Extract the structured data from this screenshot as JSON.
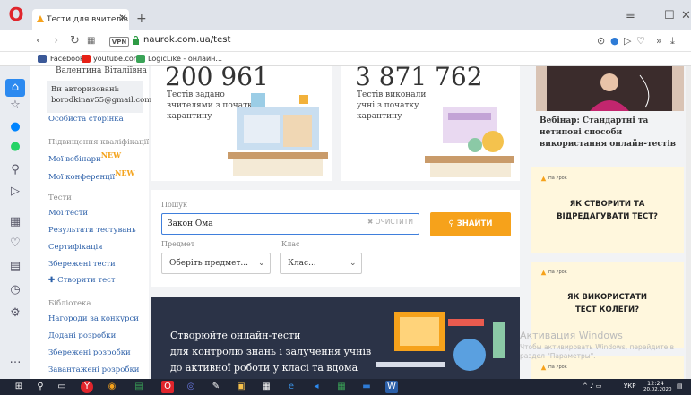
{
  "browser": {
    "tab_title": "Тести для вчителів різни",
    "tab_close": "✕",
    "new_tab": "+",
    "url": "naurok.com.ua/test",
    "vpn_label": "VPN",
    "bookmarks": [
      "Facebook",
      "youtube.com",
      "LogicLike - онлайн..."
    ]
  },
  "sidebar": {
    "user_name": "Валентина Віталіївна",
    "auth_line1": "Ви авторизовані:",
    "auth_line2": "borodkinav55@gmail.com",
    "personal_page": "Особиста сторінка",
    "sec_qualification": "Підвищення кваліфікації",
    "my_webinars": "Мої вебінари",
    "my_conferences": "Мої конференції",
    "new_badge": "NEW",
    "sec_tests": "Тести",
    "my_tests": "Мої тести",
    "test_results": "Результати тестувань",
    "certification": "Сертифікація",
    "saved_tests": "Збережені тести",
    "create_test": "Створити тест",
    "sec_library": "Бібліотека",
    "contest_awards": "Нагороди за конкурси",
    "added_works": "Додані розробки",
    "saved_works": "Збережені розробки",
    "downloaded_works": "Завантажені розробки"
  },
  "stats": {
    "tests_assigned_num": "200 961",
    "tests_assigned_l1": "Тестів задано",
    "tests_assigned_l2": "вчителями з початку",
    "tests_assigned_l3": "карантину",
    "tests_done_num": "3 871 762",
    "tests_done_l1": "Тестів виконали",
    "tests_done_l2": "учні з початку",
    "tests_done_l3": "карантину"
  },
  "search": {
    "label": "Пошук",
    "value": "Закон Ома",
    "clear_label": "ОЧИСТИТИ",
    "find_label": "ЗНАЙТИ",
    "subject_label": "Предмет",
    "subject_value": "Оберіть предмет...",
    "class_label": "Клас",
    "class_value": "Клас..."
  },
  "banner": {
    "line1": "Створюйте онлайн-тести",
    "line2": "для контролю знань і залучення учнів",
    "line3": "до активної роботи у класі та вдома"
  },
  "right": {
    "webinar_l1": "Вебінар: Стандартні та",
    "webinar_l2": "нетипові способи",
    "webinar_l3": "використання онлайн-тестів",
    "brand": "На Урок",
    "ad1_l1": "ЯК СТВОРИТИ ТА",
    "ad1_l2": "ВІДРЕДАГУВАТИ ТЕСТ?",
    "ad2_l1": "ЯК ВИКОРИСТАТИ",
    "ad2_l2": "ТЕСТ КОЛЕГИ?"
  },
  "watermark": {
    "title": "Активация Windows",
    "sub": "Чтобы активировать Windows, перейдите в раздел \"Параметры\"."
  },
  "taskbar": {
    "lang": "УКР",
    "time": "12:24",
    "date": "20.02.2020"
  },
  "colors": {
    "accent": "#f6a21b",
    "link": "#2b5fa8",
    "banner_bg": "#2b3347"
  }
}
